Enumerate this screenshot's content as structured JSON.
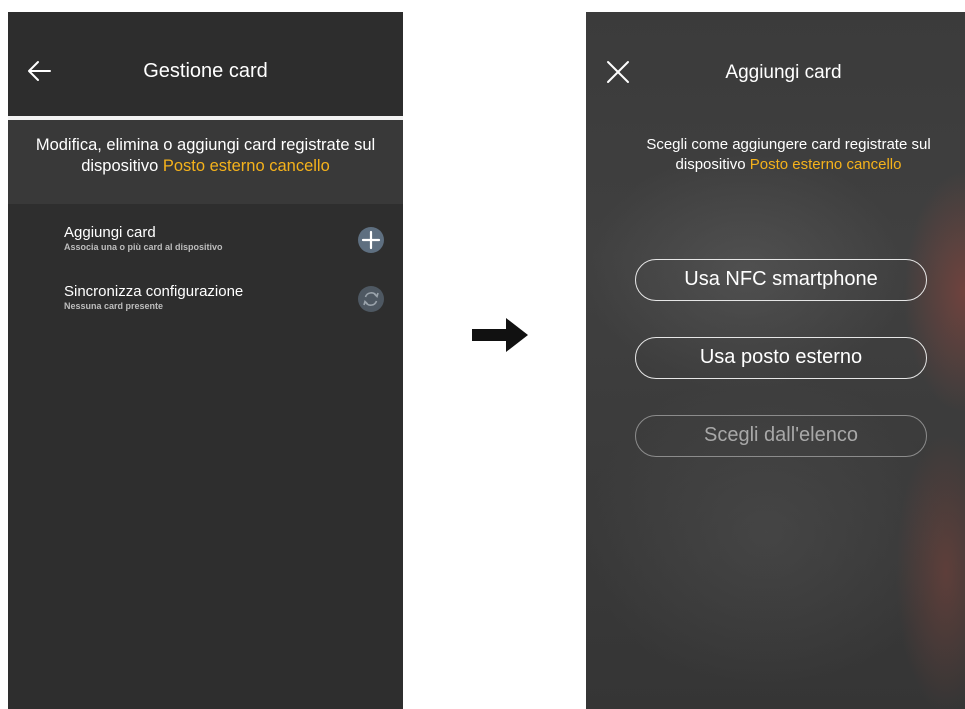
{
  "left": {
    "title": "Gestione card",
    "description_part1": "Modifica, elimina o aggiungi card registrate sul dispositivo ",
    "device_name": "Posto esterno cancello",
    "items": [
      {
        "title": "Aggiungi card",
        "subtitle": "Associa una o più card al dispositivo",
        "icon": "plus-icon"
      },
      {
        "title": "Sincronizza configurazione",
        "subtitle": "Nessuna card presente",
        "icon": "sync-icon"
      }
    ]
  },
  "arrow_icon": "right-arrow-icon",
  "right": {
    "title": "Aggiungi card",
    "description_part1": "Scegli come aggiungere card registrate sul dispositivo ",
    "device_name": "Posto esterno cancello",
    "buttons": [
      {
        "label": "Usa NFC smartphone",
        "enabled": true
      },
      {
        "label": "Usa posto esterno",
        "enabled": true
      },
      {
        "label": "Scegli dall'elenco",
        "enabled": false
      }
    ]
  },
  "colors": {
    "accent": "#f5b21b",
    "background": "#2e2e2e"
  }
}
